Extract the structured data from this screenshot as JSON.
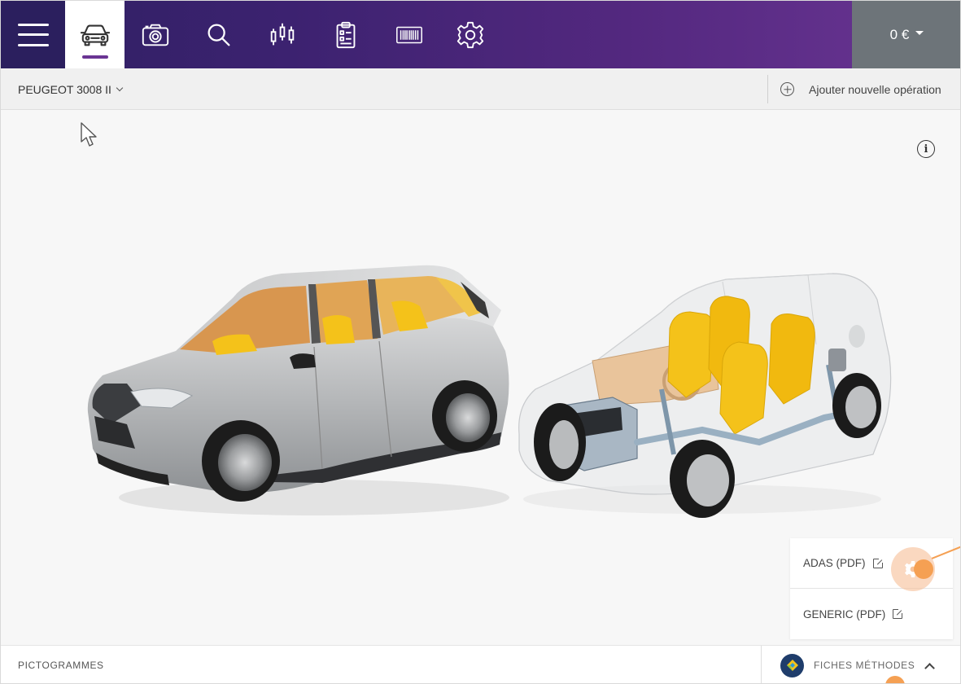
{
  "toolbar": {
    "tabs": [
      {
        "icon": "car-icon",
        "active": true
      },
      {
        "icon": "camera-icon",
        "active": false
      },
      {
        "icon": "search-icon",
        "active": false
      },
      {
        "icon": "candlestick-icon",
        "active": false
      },
      {
        "icon": "clipboard-icon",
        "active": false
      },
      {
        "icon": "barcode-icon",
        "active": false
      },
      {
        "icon": "gear-icon",
        "active": false
      }
    ],
    "price": "0 €"
  },
  "subbar": {
    "model": "PEUGEOT 3008 II",
    "add_operation": "Ajouter nouvelle opération"
  },
  "viewport": {
    "info_icon": "i"
  },
  "pdf_panel": {
    "items": [
      {
        "label": "ADAS (PDF)"
      },
      {
        "label": "GENERIC (PDF)"
      }
    ]
  },
  "bottombar": {
    "left_label": "PICTOGRAMMES",
    "right_label": "FICHES MÉTHODES"
  },
  "colors": {
    "toolbar_start": "#2f2063",
    "toolbar_end": "#6a3593",
    "price_bg": "#6d7479",
    "accent": "#f5a053",
    "car_body": "#b7b9bb",
    "seat": "#f4c21a"
  }
}
